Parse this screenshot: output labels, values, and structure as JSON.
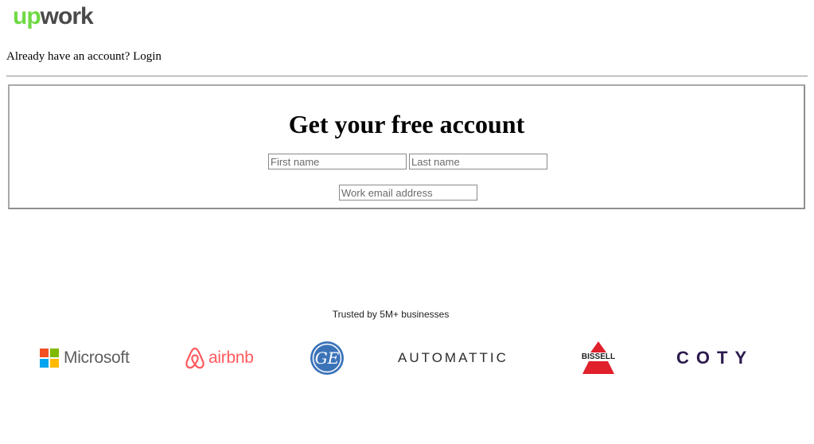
{
  "header": {
    "logo_up": "up",
    "logo_work": "work",
    "login_prompt": "Already have an account?",
    "login_link": "Login"
  },
  "signup": {
    "title": "Get your free account",
    "first_name_placeholder": "First name",
    "last_name_placeholder": "Last name",
    "email_placeholder": "Work email address"
  },
  "trusted": {
    "heading": "Trusted by 5M+ businesses",
    "brands": {
      "microsoft": "Microsoft",
      "airbnb": "airbnb",
      "ge": "GE",
      "automattic": "AUTOMATTIC",
      "bissell": "BISSELL",
      "coty": "COTY"
    }
  },
  "colors": {
    "upwork_green": "#6fda44",
    "airbnb_red": "#ff5a5f",
    "ge_blue": "#3b73b9",
    "bissell_red": "#e0202b",
    "coty_purple": "#2d1b4e"
  }
}
